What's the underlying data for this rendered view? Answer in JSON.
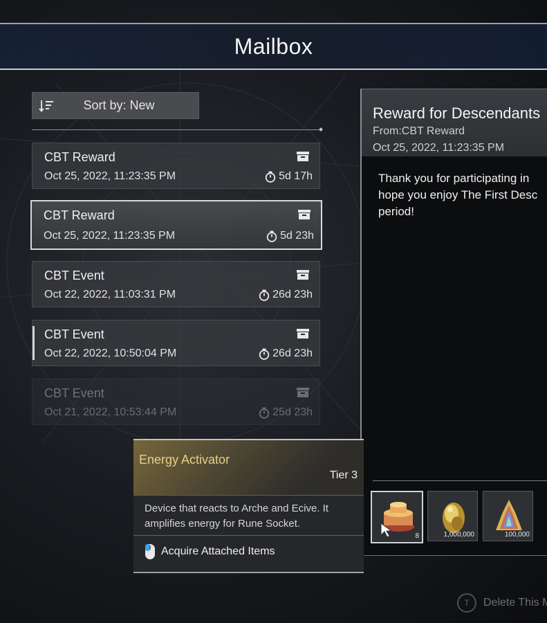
{
  "header": {
    "title": "Mailbox"
  },
  "sort": {
    "label": "Sort by: New",
    "icon": "sort-descending-icon"
  },
  "mails": [
    {
      "title": "CBT Reward",
      "date": "Oct 25, 2022, 11:23:35 PM",
      "remaining": "5d 17h",
      "state": "normal"
    },
    {
      "title": "CBT Reward",
      "date": "Oct 25, 2022, 11:23:35 PM",
      "remaining": "5d 23h",
      "state": "selected"
    },
    {
      "title": "CBT Event",
      "date": "Oct 22, 2022, 11:03:31 PM",
      "remaining": "26d 23h",
      "state": "normal"
    },
    {
      "title": "CBT Event",
      "date": "Oct 22, 2022, 10:50:04 PM",
      "remaining": "26d 23h",
      "state": "hover"
    },
    {
      "title": "CBT Event",
      "date": "Oct 21, 2022, 10:53:44 PM",
      "remaining": "25d 23h",
      "state": "faded"
    }
  ],
  "detail": {
    "title": "Reward for Descendants",
    "from": "From:CBT Reward",
    "date": "Oct 25, 2022, 11:23:35 PM",
    "body": "Thank you for participating in\nhope you enjoy The First Desc\nperiod!"
  },
  "rewards": [
    {
      "icon": "energy-activator-icon",
      "quantity": "8"
    },
    {
      "icon": "gold-coins-icon",
      "quantity": "1,000,000"
    },
    {
      "icon": "kuiper-shard-icon",
      "quantity": "100,000"
    }
  ],
  "tooltip": {
    "name": "Energy Activator",
    "tier": "Tier 3",
    "description": "Device that reacts to Arche and Ecive. It amplifies energy for Rune Socket.",
    "action": "Acquire Attached Items",
    "action_icon": "mouse-icon"
  },
  "footer": {
    "delete_label": "Delete This M",
    "delete_key": "T"
  },
  "colors": {
    "tooltip_name": "#e6cf8a",
    "accent_border": "#d9d9d9"
  }
}
